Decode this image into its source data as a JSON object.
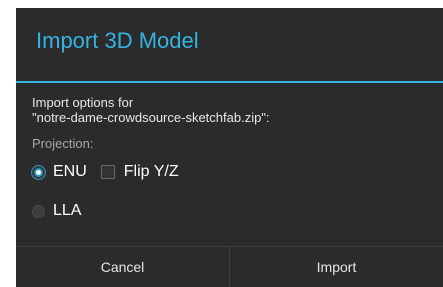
{
  "dialog": {
    "title": "Import 3D Model",
    "options_line1": "Import options for",
    "options_line2": "\"notre-dame-crowdsource-sketchfab.zip\":",
    "projection_label": "Projection:",
    "radio_enu": {
      "label": "ENU",
      "checked": true
    },
    "checkbox_flip": {
      "label": "Flip Y/Z",
      "checked": false
    },
    "radio_lla": {
      "label": "LLA",
      "checked": false
    },
    "buttons": {
      "cancel": "Cancel",
      "import": "Import"
    },
    "colors": {
      "background": "#2b2b2b",
      "accent": "#34b3e3"
    }
  }
}
